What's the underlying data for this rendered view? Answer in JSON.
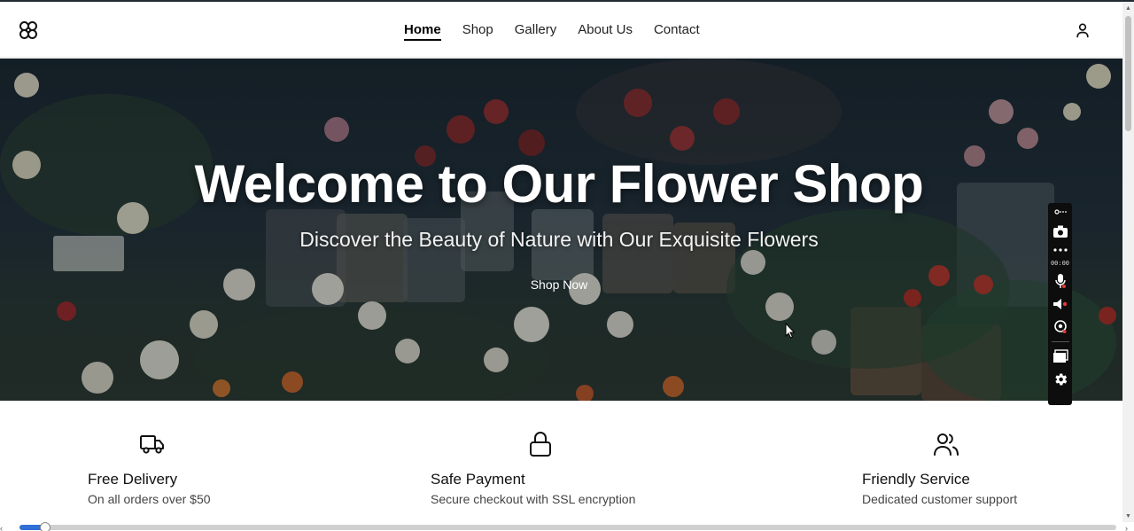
{
  "header": {
    "logo_icon": "flower-logo-icon",
    "nav": [
      {
        "label": "Home",
        "active": true
      },
      {
        "label": "Shop",
        "active": false
      },
      {
        "label": "Gallery",
        "active": false
      },
      {
        "label": "About Us",
        "active": false
      },
      {
        "label": "Contact",
        "active": false
      }
    ],
    "user_icon": "user-icon"
  },
  "hero": {
    "title": "Welcome to Our Flower Shop",
    "subtitle": "Discover the Beauty of Nature with Our Exquisite Flowers",
    "cta_label": "Shop Now"
  },
  "recorder": {
    "timer": "00:00",
    "icons": [
      "link-icon",
      "camera-icon",
      "more-icon",
      "microphone-icon",
      "speaker-icon",
      "webcam-icon",
      "screen-icon",
      "gear-icon"
    ]
  },
  "features": [
    {
      "icon": "truck-icon",
      "title": "Free Delivery",
      "text": "On all orders over $50"
    },
    {
      "icon": "lock-icon",
      "title": "Safe Payment",
      "text": "Secure checkout with SSL encryption"
    },
    {
      "icon": "users-icon",
      "title": "Friendly Service",
      "text": "Dedicated customer support"
    }
  ],
  "video_progress": 0.022,
  "colors": {
    "accent": "#2f6fd6",
    "hero_overlay": "#1b2730"
  }
}
